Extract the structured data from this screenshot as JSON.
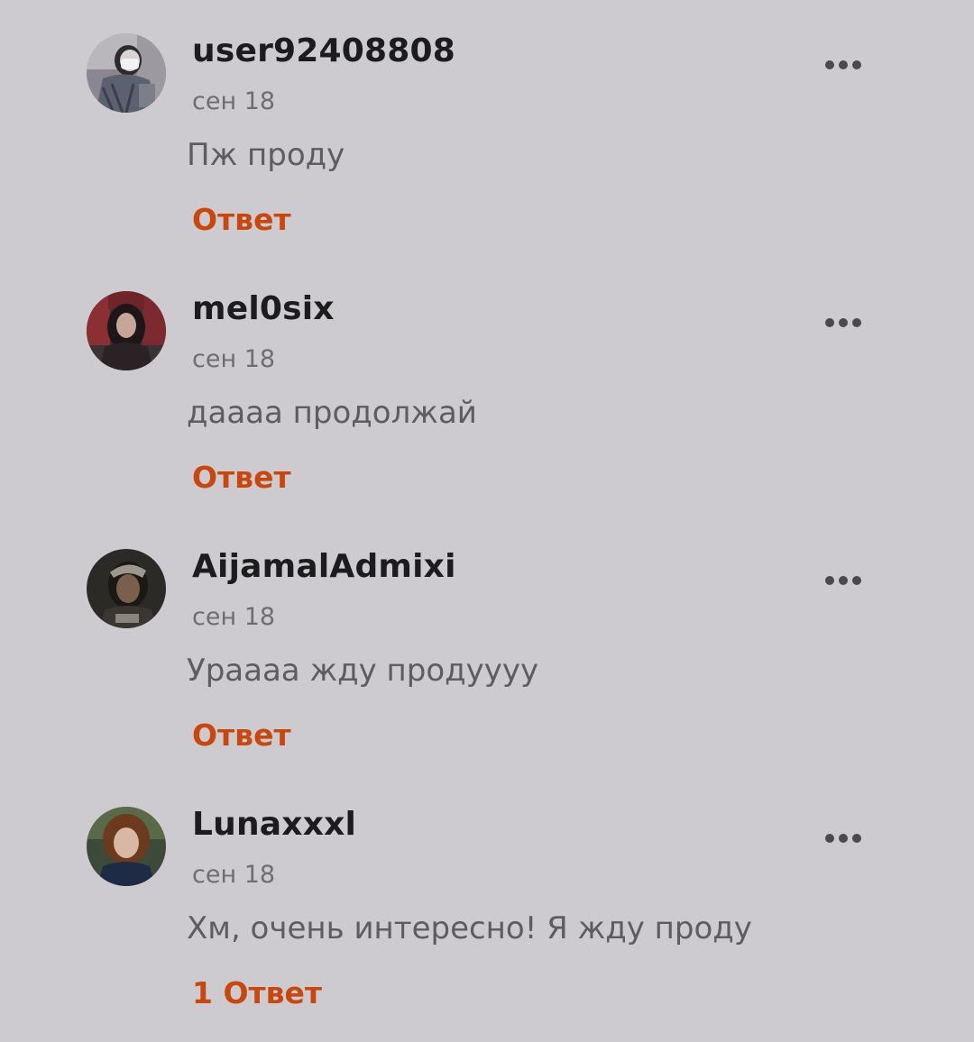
{
  "comments": [
    {
      "username": "user92408808",
      "date": "сен 18",
      "text": "Пж проду",
      "reply_label": "Ответ",
      "menu_icon": "more-horizontal-icon"
    },
    {
      "username": "mel0six",
      "date": "сен 18",
      "text": "даааа продолжай",
      "reply_label": "Ответ",
      "menu_icon": "more-horizontal-icon"
    },
    {
      "username": "AijamalAdmixi",
      "date": "сен 18",
      "text": "Урaaaa жду продуууу",
      "reply_label": "Ответ",
      "menu_icon": "more-horizontal-icon"
    },
    {
      "username": "Lunaxxxl",
      "date": "сен 18",
      "text": "Хм, очень интересно! Я жду проду",
      "reply_label": "1 Ответ",
      "menu_icon": "more-horizontal-icon"
    }
  ],
  "colors": {
    "background": "#cdcbcf",
    "username": "#1c1c1e",
    "date": "#6e6d72",
    "text": "#5d5c61",
    "reply": "#c7470f",
    "menu_dots": "#4a494d"
  }
}
